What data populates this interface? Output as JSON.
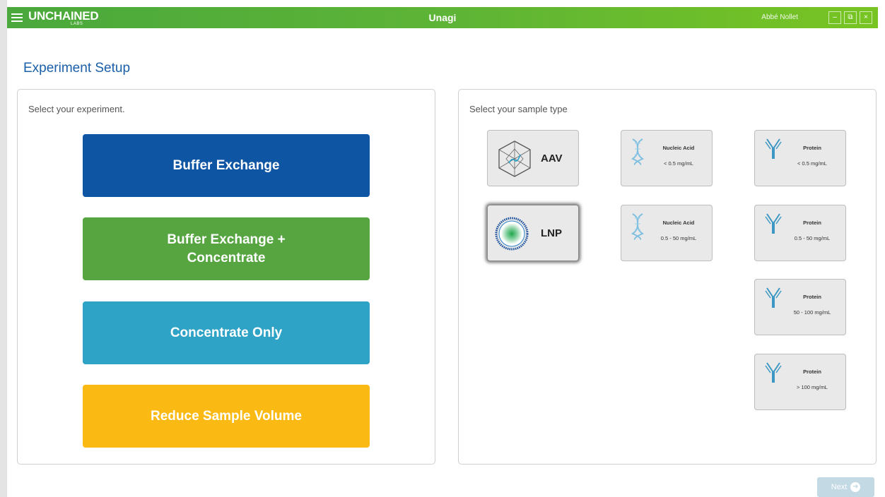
{
  "titlebar": {
    "logo_main": "UNCHAINED",
    "logo_sub": "LABS",
    "app_title": "Unagi",
    "username": "Abbé Nollet",
    "minimize_label": "–",
    "maximize_label": "⧉",
    "close_label": "×"
  },
  "page": {
    "title": "Experiment Setup"
  },
  "experiment_panel": {
    "heading": "Select your experiment.",
    "options": [
      {
        "label": "Buffer Exchange",
        "color": "#0e55a4"
      },
      {
        "label": "Buffer Exchange +\nConcentrate",
        "color": "#56a540"
      },
      {
        "label": "Concentrate Only",
        "color": "#2ea3c6"
      },
      {
        "label": "Reduce Sample Volume",
        "color": "#fbba13"
      }
    ]
  },
  "sample_panel": {
    "heading": "Select your sample type",
    "tiles": [
      {
        "name": "AAV",
        "icon": "aav-capsid-icon"
      },
      {
        "name": "LNP",
        "icon": "lnp-particle-icon",
        "selected": true
      },
      {
        "name": "Nucleic Acid",
        "range": "< 0.5 mg/mL",
        "icon": "dna-icon"
      },
      {
        "name": "Nucleic Acid",
        "range": "0.5 - 50 mg/mL",
        "icon": "dna-icon"
      },
      {
        "name": "Protein",
        "range": "< 0.5 mg/mL",
        "icon": "antibody-icon"
      },
      {
        "name": "Protein",
        "range": "0.5 - 50 mg/mL",
        "icon": "antibody-icon"
      },
      {
        "name": "Protein",
        "range": "50 - 100 mg/mL",
        "icon": "antibody-icon"
      },
      {
        "name": "Protein",
        "range": "> 100 mg/mL",
        "icon": "antibody-icon"
      }
    ]
  },
  "footer": {
    "next_label": "Next"
  }
}
